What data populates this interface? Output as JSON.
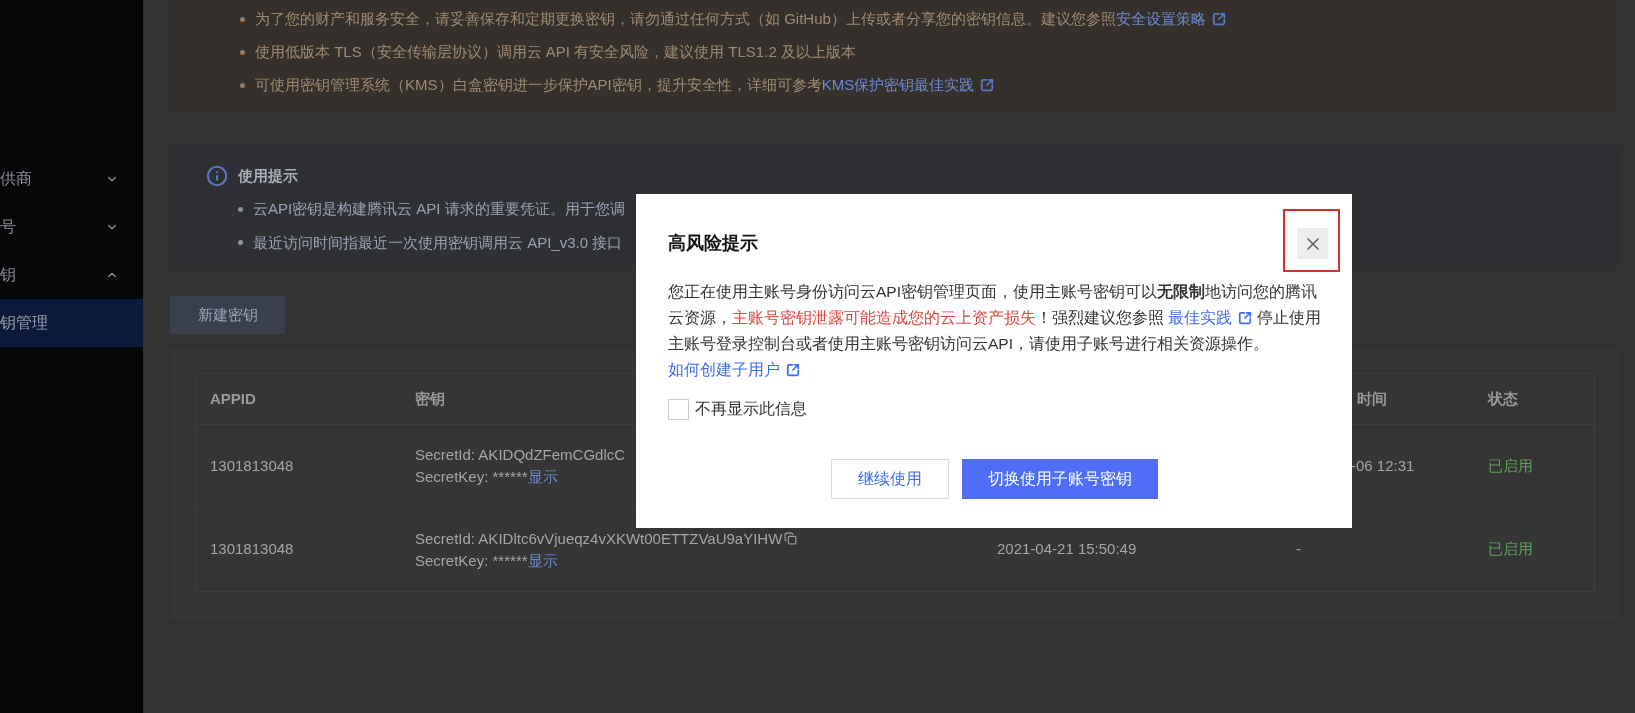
{
  "sidebar": {
    "items": [
      {
        "label": "供商",
        "expanded": false,
        "selected": false
      },
      {
        "label": "号",
        "expanded": false,
        "selected": false
      },
      {
        "label": "钥",
        "expanded": true,
        "selected": false,
        "children": [
          {
            "label": "钥管理",
            "selected": true
          }
        ]
      }
    ]
  },
  "warning_notice": {
    "items": [
      {
        "text": "为了您的财产和服务安全，请妥善保存和定期更换密钥，请勿通过任何方式（如 GitHub）上传或者分享您的密钥信息。建议您参照",
        "link": "安全设置策略"
      },
      {
        "text": "使用低版本 TLS（安全传输层协议）调用云 API 有安全风险，建议使用 TLS1.2 及以上版本"
      },
      {
        "text": "可使用密钥管理系统（KMS）白盒密钥进一步保护API密钥，提升安全性，详细可参考",
        "link": "KMS保护密钥最佳实践"
      }
    ]
  },
  "usage_tips": {
    "title": "使用提示",
    "items": [
      "云API密钥是构建腾讯云 API 请求的重要凭证。用于您调",
      "最近访问时间指最近一次使用密钥调用云 API_v3.0 接口"
    ]
  },
  "new_key_button": {
    "label": "新建密钥"
  },
  "table": {
    "columns": {
      "appid": "APPID",
      "secret": "密钥",
      "last_access": "时间",
      "status": "状态"
    },
    "rows": [
      {
        "appid": "1301813048",
        "secret_id": "SecretId: AKIDQdZFemCGdlcC",
        "secret_key": "SecretKey: ******",
        "show_link": "显示",
        "last_access": "-06 12:31",
        "status": "已启用"
      },
      {
        "appid": "1301813048",
        "secret_id": "SecretId: AKIDltc6vVjueqz4vXKWt00ETTZVaU9aYIHW",
        "copyable": true,
        "secret_key": "SecretKey: ******",
        "show_link": "显示",
        "created": "2021-04-21 15:50:49",
        "last_access": "-",
        "status": "已启用"
      }
    ]
  },
  "dialog": {
    "title": "高风险提示",
    "close_highlighted": true,
    "body": [
      {
        "kind": "plain",
        "text": "您正在使用主账号身份访问云API密钥管理页面，使用主账号密钥可以**无限制**地访问您的腾讯云资源，"
      },
      {
        "kind": "warning",
        "text": "主账号密钥泄露可能造成您的云上资产损失"
      },
      {
        "kind": "plain",
        "text": "！强烈建议您参照 "
      },
      {
        "kind": "link",
        "text": "最佳实践"
      },
      {
        "kind": "plain",
        "text": " 停止使用主账号登录控制台或者使用主账号密钥访问云API，请使用子账号进行相关资源操作。"
      },
      {
        "kind": "link",
        "text": "如何创建子用户"
      }
    ],
    "checkbox": {
      "label": "不再显示此信息",
      "checked": false
    },
    "buttons": [
      {
        "label": "继续使用",
        "kind": "secondary"
      },
      {
        "label": "切换使用子账号密钥",
        "kind": "primary"
      }
    ]
  }
}
